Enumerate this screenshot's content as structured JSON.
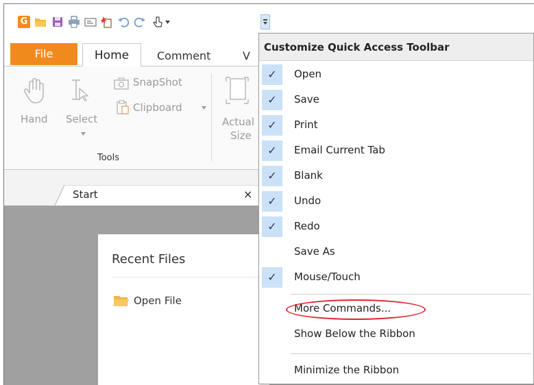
{
  "quick_access": {
    "icons": [
      "app-logo-icon",
      "open-folder-icon",
      "save-icon",
      "print-icon",
      "email-icon",
      "blank-icon",
      "undo-icon",
      "redo-icon",
      "mouse-touch-icon",
      "customize-dropdown-icon"
    ]
  },
  "ribbon_tabs": {
    "file": "File",
    "home": "Home",
    "comment": "Comment",
    "view_partial": "V"
  },
  "ribbon": {
    "hand": "Hand",
    "select": "Select",
    "snapshot": "SnapShot",
    "clipboard": "Clipboard",
    "actual": "Actual",
    "size": "Size",
    "group_tools": "Tools"
  },
  "doc_tab": {
    "label": "Start",
    "close": "×"
  },
  "start_page": {
    "recent_files": "Recent Files",
    "open_file": "Open File"
  },
  "menu": {
    "title": "Customize Quick Access Toolbar",
    "items": [
      {
        "label": "Open",
        "checked": true
      },
      {
        "label": "Save",
        "checked": true
      },
      {
        "label": "Print",
        "checked": true
      },
      {
        "label": "Email Current Tab",
        "checked": true
      },
      {
        "label": "Blank",
        "checked": true
      },
      {
        "label": "Undo",
        "checked": true
      },
      {
        "label": "Redo",
        "checked": true
      },
      {
        "label": "Save As",
        "checked": false
      },
      {
        "label": "Mouse/Touch",
        "checked": true
      }
    ],
    "more_commands": "More Commands...",
    "show_below": "Show Below the Ribbon",
    "minimize": "Minimize the Ribbon"
  },
  "colors": {
    "accent_orange": "#f18a1d",
    "check_bg": "#cbe1f7",
    "highlight_oval": "#e0242b"
  }
}
